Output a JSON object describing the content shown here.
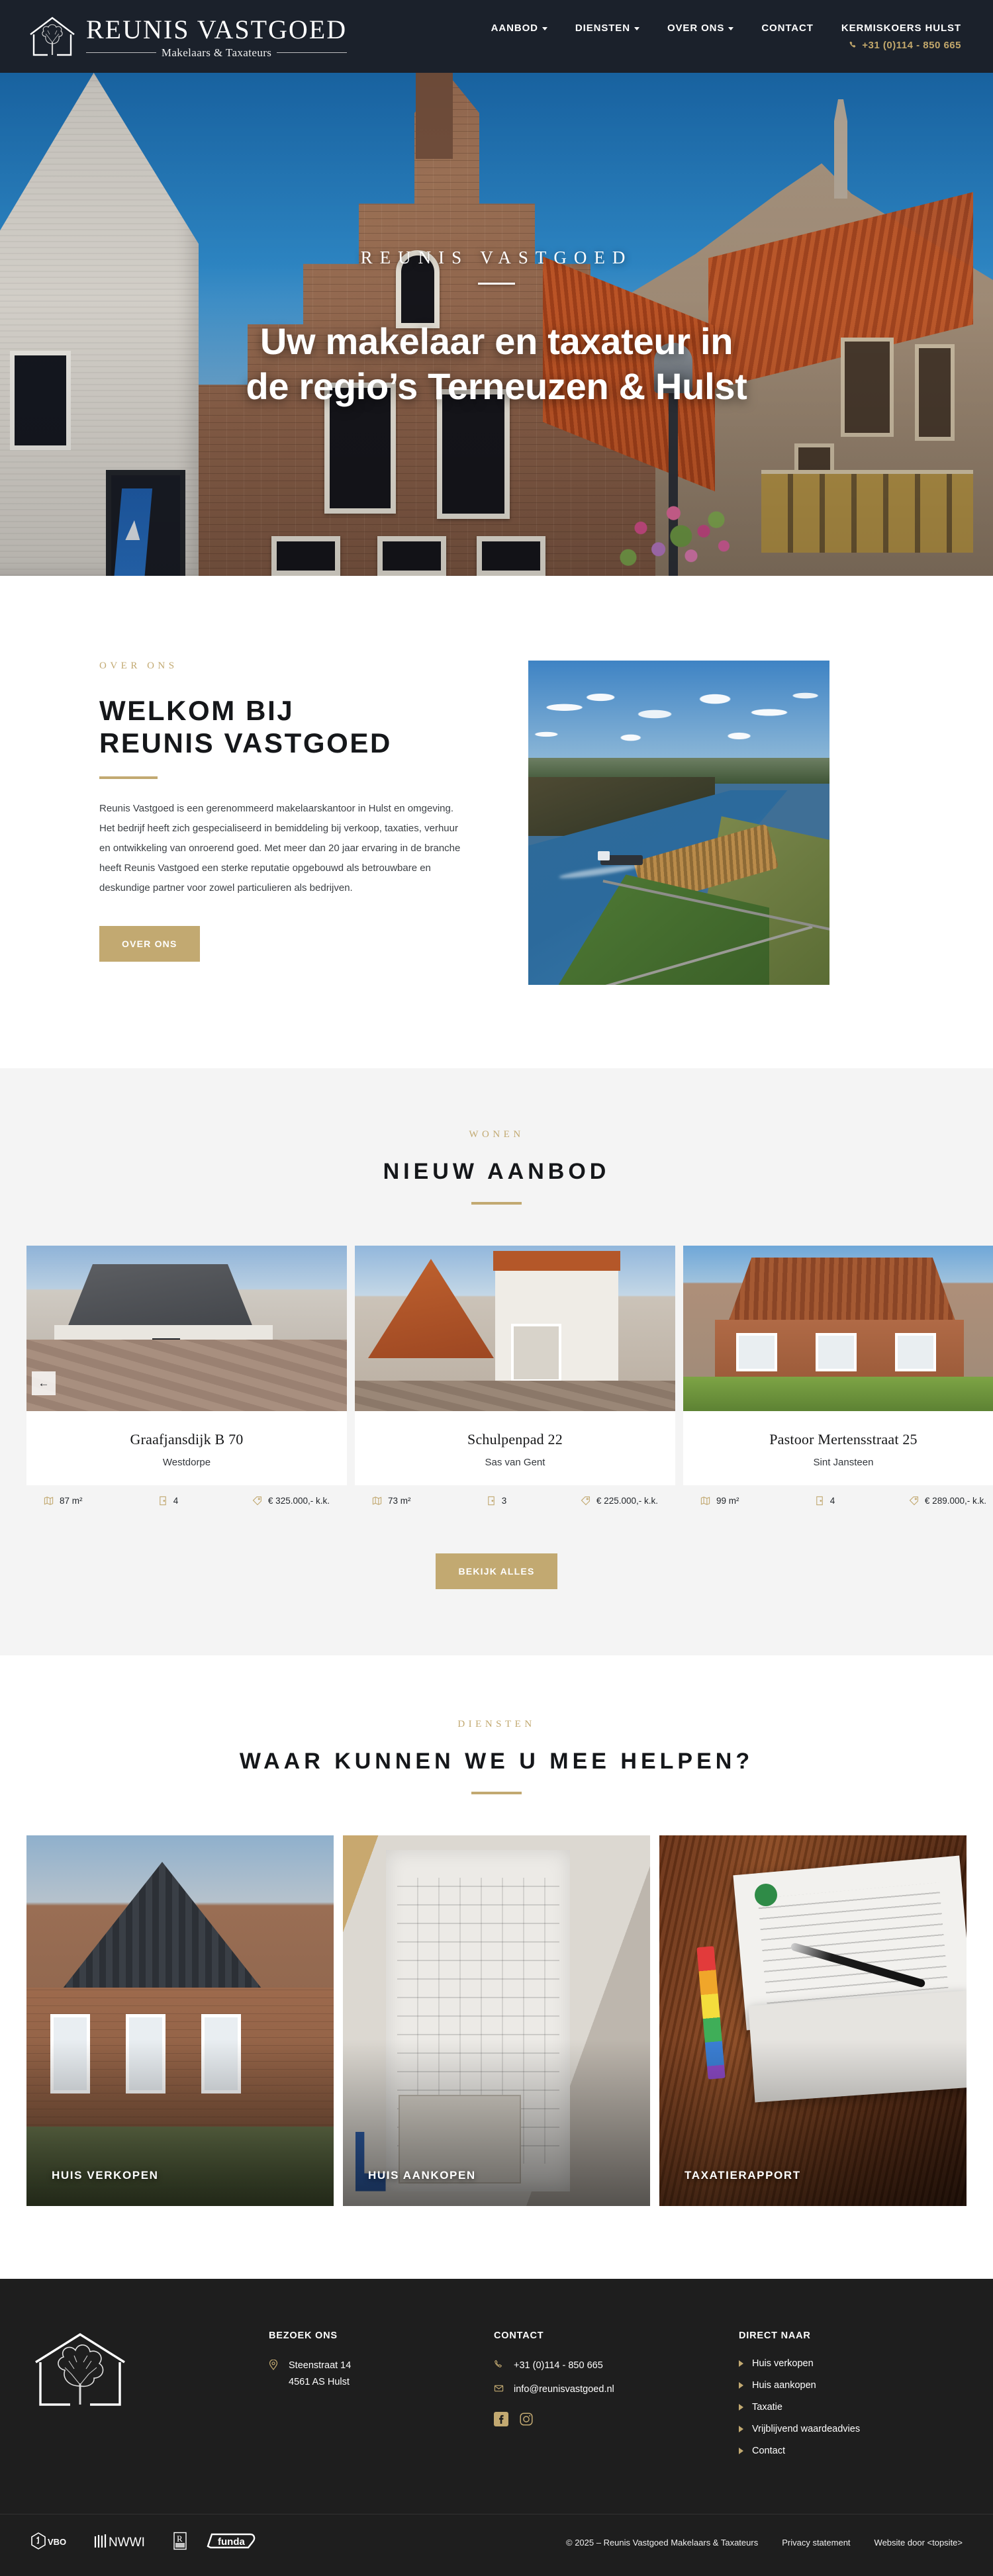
{
  "brand": {
    "title": "REUNIS VASTGOED",
    "subtitle": "Makelaars & Taxateurs"
  },
  "nav": {
    "items": [
      {
        "label": "AANBOD",
        "has_dropdown": true
      },
      {
        "label": "DIENSTEN",
        "has_dropdown": true
      },
      {
        "label": "OVER ONS",
        "has_dropdown": true
      },
      {
        "label": "CONTACT",
        "has_dropdown": false
      },
      {
        "label": "KERMISKOERS HULST",
        "has_dropdown": false
      }
    ],
    "phone": "+31 (0)114 - 850 665",
    "phone_icon": "phone-icon"
  },
  "hero": {
    "eyebrow": "REUNIS VASTGOED",
    "title_line1": "Uw makelaar en taxateur in",
    "title_line2": "de regio’s Terneuzen & Hulst"
  },
  "about": {
    "eyebrow": "OVER ONS",
    "heading_line1": "WELKOM BIJ",
    "heading_line2": "REUNIS VASTGOED",
    "paragraph": "Reunis Vastgoed is een gerenommeerd makelaarskantoor in Hulst en omgeving. Het bedrijf heeft zich gespecialiseerd in bemiddeling bij verkoop, taxaties, verhuur en ontwikkeling van onroerend goed. Met meer dan 20 jaar ervaring in de branche heeft Reunis Vastgoed een sterke reputatie opgebouwd als betrouwbare en deskundige partner voor zowel particulieren als bedrijven.",
    "button": "OVER ONS",
    "image_alt": "aerial-canal-photo"
  },
  "listings": {
    "eyebrow": "WONEN",
    "heading": "NIEUW AANBOD",
    "prev_arrow": "←",
    "button": "BEKIJK ALLES",
    "cards": [
      {
        "title": "Graafjansdijk B 70",
        "city": "Westdorpe",
        "area": "87 m²",
        "rooms": "4",
        "price": "€ 325.000,- k.k."
      },
      {
        "title": "Schulpenpad 22",
        "city": "Sas van Gent",
        "area": "73 m²",
        "rooms": "3",
        "price": "€ 225.000,- k.k."
      },
      {
        "title": "Pastoor Mertensstraat 25",
        "city": "Sint Jansteen",
        "area": "99 m²",
        "rooms": "4",
        "price": "€ 289.000,- k.k."
      }
    ],
    "meta_icons": {
      "area": "map-icon",
      "rooms": "door-icon",
      "price": "tag-icon"
    }
  },
  "services": {
    "eyebrow": "DIENSTEN",
    "heading": "WAAR KUNNEN WE U MEE HELPEN?",
    "items": [
      {
        "label": "HUIS VERKOPEN"
      },
      {
        "label": "HUIS AANKOPEN"
      },
      {
        "label": "TAXATIERAPPORT"
      }
    ]
  },
  "footer": {
    "logo_icon": "house-tree-logo",
    "visit": {
      "title": "BEZOEK ONS",
      "address_line1": "Steenstraat 14",
      "address_line2": "4561 AS Hulst",
      "icon": "location-pin-icon"
    },
    "contact": {
      "title": "CONTACT",
      "phone": "+31 (0)114 - 850 665",
      "email": "info@reunisvastgoed.nl",
      "phone_icon": "phone-icon",
      "email_icon": "envelope-icon",
      "social": [
        {
          "name": "facebook-icon",
          "glyph": "f"
        },
        {
          "name": "instagram-icon",
          "glyph": "◎"
        }
      ]
    },
    "direct": {
      "title": "DIRECT NAAR",
      "links": [
        "Huis verkopen",
        "Huis aankopen",
        "Taxatie",
        "Vrijblijvend waardeadvies",
        "Contact"
      ]
    },
    "partners": [
      "VBO",
      "NWWI",
      "NRVT",
      "funda"
    ],
    "copyright": "© 2025 – Reunis Vastgoed Makelaars & Taxateurs",
    "privacy": "Privacy statement",
    "credit": "Website door <topsite>"
  },
  "colors": {
    "gold": "#c2a971",
    "dark_header": "#1b212b",
    "footer_dark": "#1e1e1e",
    "section_grey": "#f4f4f4"
  }
}
